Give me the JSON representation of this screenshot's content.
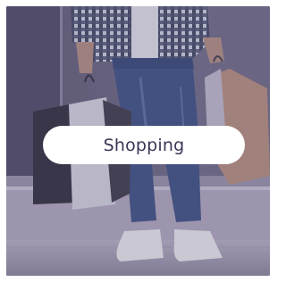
{
  "card": {
    "label": "Shopping",
    "image": "shopping-person-with-bags-photo",
    "overlay_color": "#5d5873",
    "label_color": "#3a3656"
  }
}
